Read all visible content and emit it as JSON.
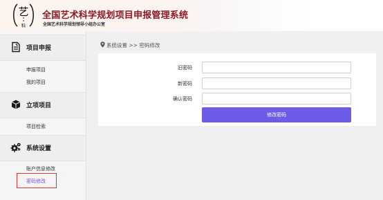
{
  "header": {
    "title": "全国艺术科学规划项目申报管理系统",
    "subtitle": "全国艺术科学规划领导小组办公室",
    "logo_char_main": "艺",
    "logo_char_sub": "科",
    "title_color": "#8c1a26"
  },
  "sidebar": {
    "sections": [
      {
        "label": "项目申报",
        "icon": "document-edit-icon",
        "items": [
          "申报项目",
          "我的项目"
        ]
      },
      {
        "label": "立项项目",
        "icon": "cube-icon",
        "items": [
          "项目检索"
        ]
      },
      {
        "label": "系统设置",
        "icon": "gears-icon",
        "items": [
          "账户信息修改",
          "密码修改"
        ]
      }
    ],
    "active_item": "密码修改",
    "active_color": "#6c52e8",
    "highlight_color": "#e0322d"
  },
  "breadcrumb": {
    "text": "系统设置 >> 密码修改"
  },
  "form": {
    "old_password_label": "旧密码",
    "old_password_value": "",
    "new_password_label": "新密码",
    "new_password_value": "",
    "confirm_password_label": "确认密码",
    "confirm_password_value": "",
    "submit_label": "修改密码",
    "button_color": "#6c5ce7"
  }
}
